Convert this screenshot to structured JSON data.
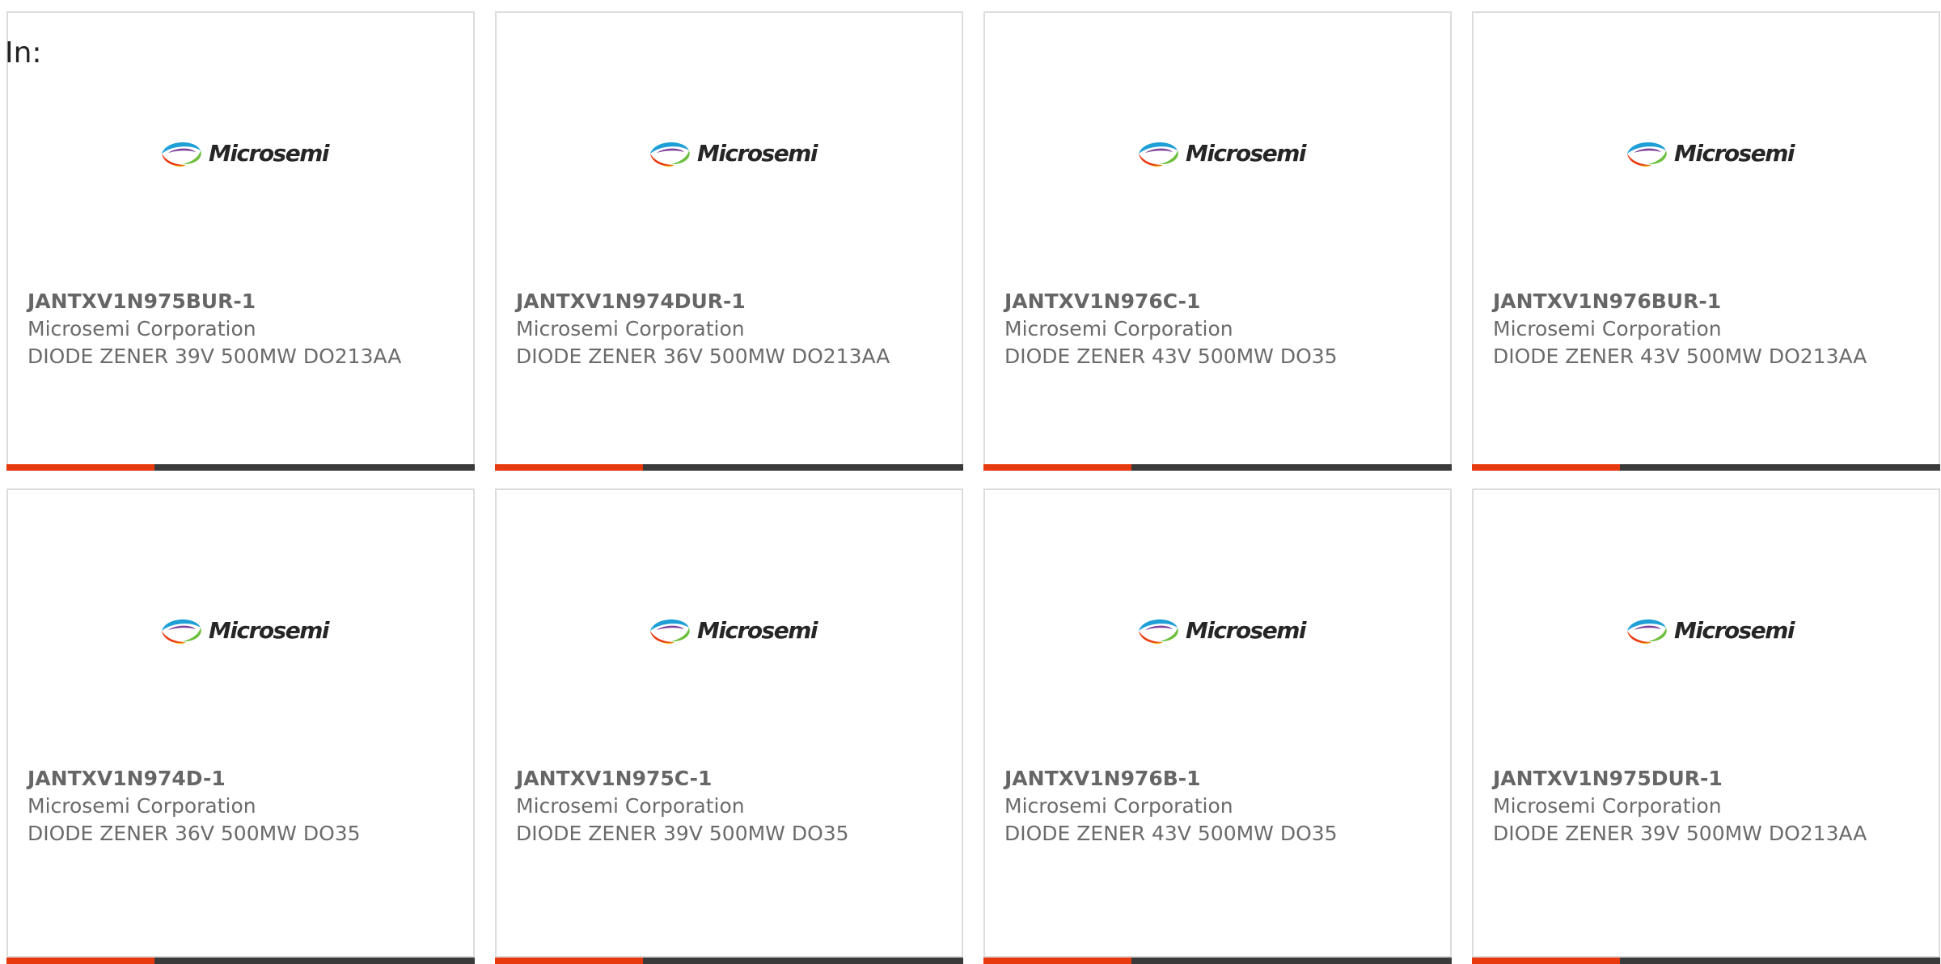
{
  "filter_label": "In:",
  "logo": {
    "name": "Microsemi",
    "colors": [
      "#1e9fd6",
      "#6cbf3c",
      "#f2b51c",
      "#e8390e",
      "#7a3f98"
    ]
  },
  "accent_color": "#e8390e",
  "products": [
    {
      "part": "JANTXV1N975BUR-1",
      "manufacturer": "Microsemi Corporation",
      "desc": "DIODE ZENER 39V 500MW DO213AA"
    },
    {
      "part": "JANTXV1N974DUR-1",
      "manufacturer": "Microsemi Corporation",
      "desc": "DIODE ZENER 36V 500MW DO213AA"
    },
    {
      "part": "JANTXV1N976C-1",
      "manufacturer": "Microsemi Corporation",
      "desc": "DIODE ZENER 43V 500MW DO35"
    },
    {
      "part": "JANTXV1N976BUR-1",
      "manufacturer": "Microsemi Corporation",
      "desc": "DIODE ZENER 43V 500MW DO213AA"
    },
    {
      "part": "JANTXV1N974D-1",
      "manufacturer": "Microsemi Corporation",
      "desc": "DIODE ZENER 36V 500MW DO35"
    },
    {
      "part": "JANTXV1N975C-1",
      "manufacturer": "Microsemi Corporation",
      "desc": "DIODE ZENER 39V 500MW DO35"
    },
    {
      "part": "JANTXV1N976B-1",
      "manufacturer": "Microsemi Corporation",
      "desc": "DIODE ZENER 43V 500MW DO35"
    },
    {
      "part": "JANTXV1N975DUR-1",
      "manufacturer": "Microsemi Corporation",
      "desc": "DIODE ZENER 39V 500MW DO213AA"
    }
  ]
}
